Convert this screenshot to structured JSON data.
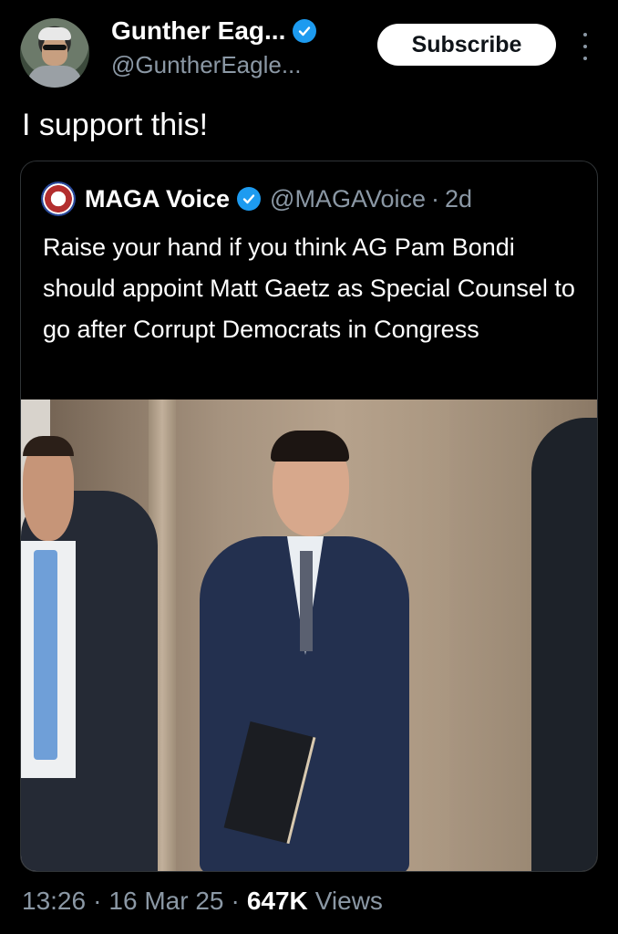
{
  "author": {
    "display_name": "Gunther Eag...",
    "handle": "@GuntherEagle...",
    "verified": true
  },
  "actions": {
    "subscribe_label": "Subscribe"
  },
  "tweet": {
    "text": "I support this!"
  },
  "quoted": {
    "display_name": "MAGA Voice",
    "handle": "@MAGAVoice",
    "separator": "·",
    "age": "2d",
    "text": "Raise your hand if you think AG Pam Bondi should appoint Matt Gaetz as Special Counsel to go after Corrupt Democrats in Congress"
  },
  "meta": {
    "time": "13:26",
    "sep1": "·",
    "date": "16 Mar 25",
    "sep2": "·",
    "views_count": "647K",
    "views_label": "Views"
  },
  "colors": {
    "background": "#000000",
    "accent": "#1d9bf0",
    "muted": "#8b98a5"
  }
}
